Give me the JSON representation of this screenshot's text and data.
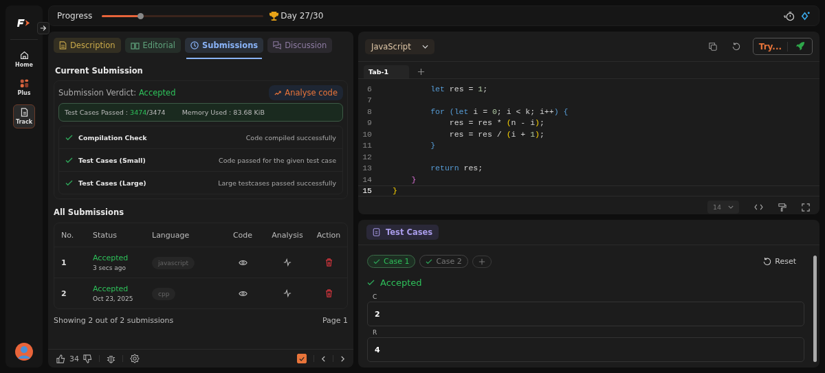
{
  "sidebar": {
    "items": [
      {
        "label": "Home",
        "selected": false
      },
      {
        "label": "Plus",
        "selected": false
      },
      {
        "label": "Track",
        "selected": true
      }
    ]
  },
  "top_bar": {
    "label": "Progress",
    "level": 0.24,
    "day": "Day 27/30"
  },
  "tabs": [
    {
      "label": "Description",
      "color": "#c9a94a",
      "selected": false
    },
    {
      "label": "Editorial",
      "color": "#5fa37c",
      "selected": false
    },
    {
      "label": "Submissions",
      "color": "#8ab4f8",
      "selected": true
    },
    {
      "label": "Discussion",
      "color": "#8e7ca3",
      "selected": false
    }
  ],
  "current": {
    "title": "Current Submission",
    "verdict_label": "Submission Verdict:",
    "verdict": "Accepted",
    "analyse": "Analyse code",
    "passed_label": "Test Cases Passed :",
    "passed": "3474",
    "total": "/3474",
    "memory": "Memory Used : 83.68 KiB",
    "checks": [
      {
        "name": "Compilation Check",
        "result": "Code compiled successfully",
        "passed": true
      },
      {
        "name": "Test Cases (Small)",
        "result": "Code passed for the given test case",
        "passed": true
      },
      {
        "name": "Test Cases (Large)",
        "result": "Large testcases passed successfully",
        "passed": true
      }
    ]
  },
  "all": {
    "title": "All Submissions",
    "columns": [
      "No.",
      "Status",
      "Language",
      "Code",
      "Analysis",
      "Action"
    ],
    "rows": [
      {
        "no": "1",
        "status": "Accepted",
        "time": "3 secs ago",
        "language": "javascript"
      },
      {
        "no": "2",
        "status": "Accepted",
        "time": "Oct 23, 2025",
        "language": "cpp"
      }
    ],
    "showing": "Showing 2 out of 2 submissions",
    "page": "Page 1"
  },
  "footer": {
    "likes": "34",
    "checked": true
  },
  "editor": {
    "language": "JavaScript",
    "try": "Try...",
    "tabs": [
      {
        "label": "Tab-1",
        "selected": true
      }
    ],
    "font_size": "14",
    "lines": [
      {
        "no": "6",
        "tokens": [
          {
            "kind": "kw",
            "text": "        let"
          },
          {
            "kind": "id",
            "text": " res = "
          },
          {
            "kind": "num",
            "text": "1"
          },
          {
            "kind": "id",
            "text": ";"
          }
        ]
      },
      {
        "no": "7"
      },
      {
        "no": "8",
        "tokens": [
          {
            "kind": "kw",
            "text": "        for ("
          },
          {
            "kind": "kw",
            "text": "let"
          },
          {
            "kind": "id",
            "text": " i = "
          },
          {
            "kind": "num",
            "text": "0"
          },
          {
            "kind": "id",
            "text": "; i < k; i++"
          },
          {
            "kind": "kw",
            "text": ") {"
          }
        ]
      },
      {
        "no": "9",
        "tokens": [
          {
            "kind": "id",
            "text": "            res = res * "
          },
          {
            "kind": "paren",
            "text": "("
          },
          {
            "kind": "id",
            "text": "n - i"
          },
          {
            "kind": "paren",
            "text": ")"
          },
          {
            "kind": "id",
            "text": ";"
          }
        ]
      },
      {
        "no": "10",
        "tokens": [
          {
            "kind": "id",
            "text": "            res = res / "
          },
          {
            "kind": "paren",
            "text": "("
          },
          {
            "kind": "id",
            "text": "i + "
          },
          {
            "kind": "num",
            "text": "1"
          },
          {
            "kind": "paren",
            "text": ")"
          },
          {
            "kind": "id",
            "text": ";"
          }
        ]
      },
      {
        "no": "11",
        "tokens": [
          {
            "kind": "kw",
            "text": "        }"
          }
        ]
      },
      {
        "no": "12"
      },
      {
        "no": "13",
        "tokens": [
          {
            "kind": "kw",
            "text": "        return"
          },
          {
            "kind": "id",
            "text": " res;"
          }
        ]
      },
      {
        "no": "14",
        "tokens": [
          {
            "kind": "brace",
            "text": "    }"
          }
        ]
      },
      {
        "no": "15",
        "tokens": [
          {
            "kind": "paren",
            "text": "}"
          }
        ],
        "selected": true
      }
    ]
  },
  "testcases": {
    "title": "Test Cases",
    "reset": "Reset",
    "result": "Accepted",
    "cases": [
      {
        "label": "Case 1",
        "selected": true
      },
      {
        "label": "Case 2",
        "selected": false
      }
    ],
    "fields": [
      {
        "label": "C",
        "value": "2"
      },
      {
        "label": "R",
        "value": "4"
      }
    ]
  }
}
